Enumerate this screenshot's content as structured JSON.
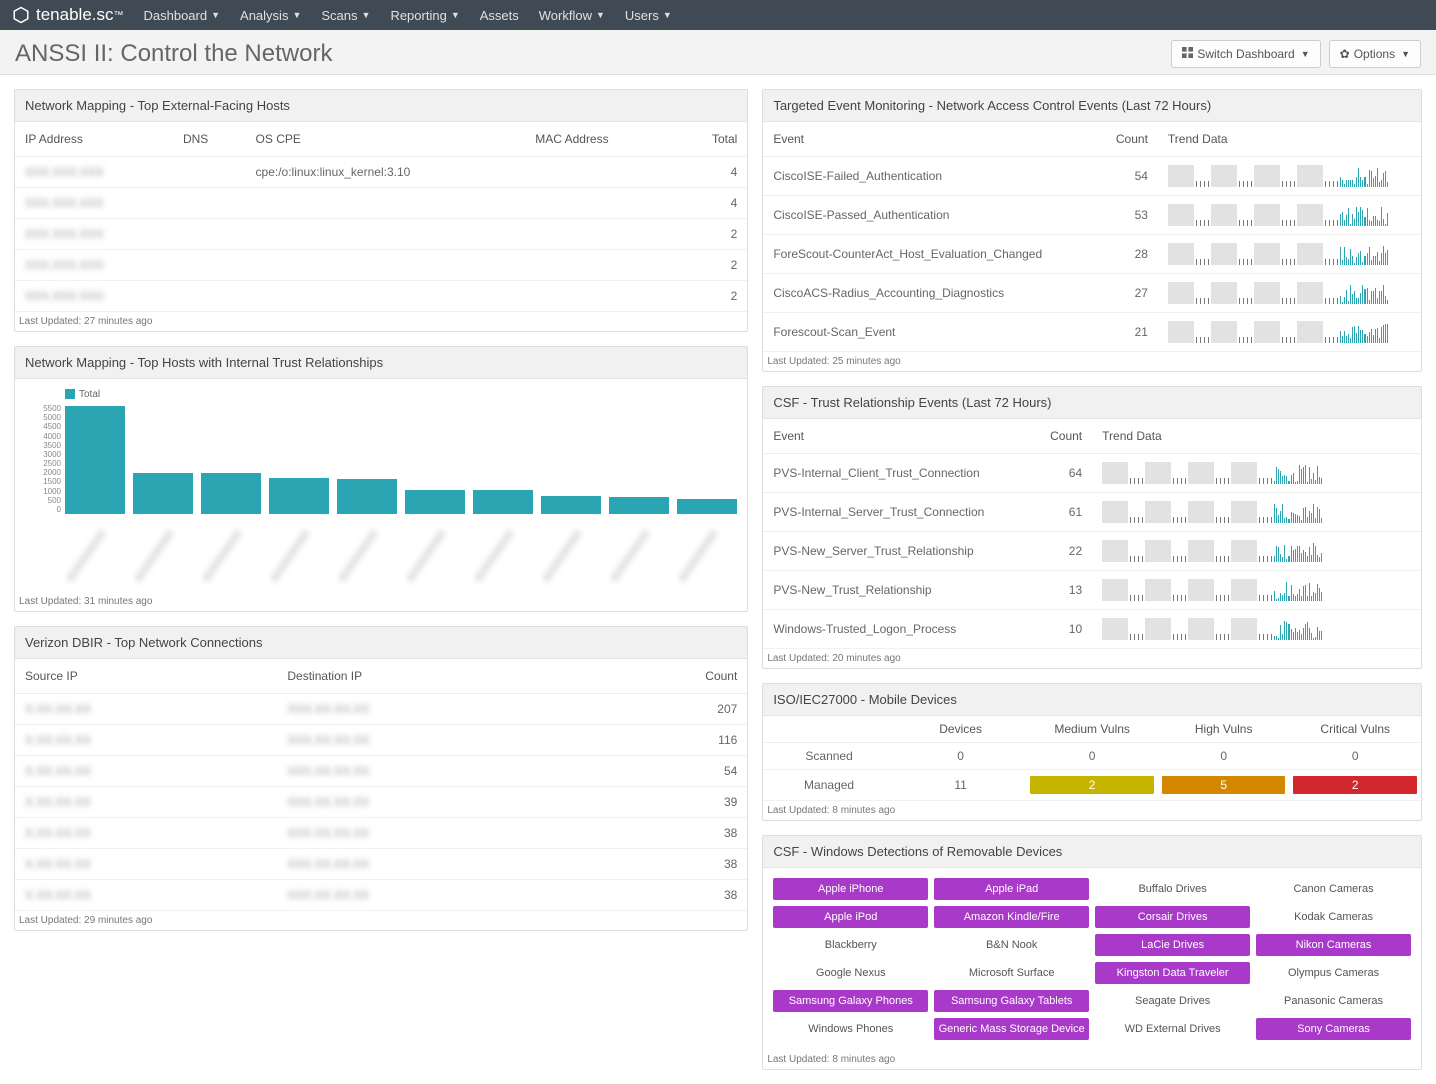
{
  "nav": {
    "brand": "tenable.sc",
    "items": [
      "Dashboard",
      "Analysis",
      "Scans",
      "Reporting",
      "Assets",
      "Workflow",
      "Users"
    ]
  },
  "header": {
    "title": "ANSSI II: Control the Network",
    "switch_label": "Switch Dashboard",
    "options_label": "Options"
  },
  "panels": {
    "ext_hosts": {
      "title": "Network Mapping - Top External-Facing Hosts",
      "columns": [
        "IP Address",
        "DNS",
        "OS CPE",
        "MAC Address",
        "Total"
      ],
      "rows": [
        {
          "ip": "XXX.XXX.XXX",
          "dns": "",
          "cpe": "cpe:/o:linux:linux_kernel:3.10",
          "mac": "",
          "total": 4
        },
        {
          "ip": "XXX.XXX.XXX",
          "dns": "",
          "cpe": "",
          "mac": "",
          "total": 4
        },
        {
          "ip": "XXX.XXX.XXX",
          "dns": "",
          "cpe": "",
          "mac": "",
          "total": 2
        },
        {
          "ip": "XXX.XXX.XXX",
          "dns": "",
          "cpe": "",
          "mac": "",
          "total": 2
        },
        {
          "ip": "XXX.XXX.XXX",
          "dns": "",
          "cpe": "",
          "mac": "",
          "total": 2
        }
      ],
      "footer": "Last Updated: 27 minutes ago"
    },
    "trust_hosts": {
      "title": "Network Mapping - Top Hosts with Internal Trust Relationships",
      "legend": "Total",
      "footer": "Last Updated: 31 minutes ago"
    },
    "dbir": {
      "title": "Verizon DBIR - Top Network Connections",
      "columns": [
        "Source IP",
        "Destination IP",
        "Count"
      ],
      "rows": [
        {
          "src": "X.XX.XX.XX",
          "dst": "XXX.XX.XX.XX",
          "count": 207
        },
        {
          "src": "X.XX.XX.XX",
          "dst": "XXX.XX.XX.XX",
          "count": 116
        },
        {
          "src": "X.XX.XX.XX",
          "dst": "XXX.XX.XX.XX",
          "count": 54
        },
        {
          "src": "X.XX.XX.XX",
          "dst": "XXX.XX.XX.XX",
          "count": 39
        },
        {
          "src": "X.XX.XX.XX",
          "dst": "XXX.XX.XX.XX",
          "count": 38
        },
        {
          "src": "X.XX.XX.XX",
          "dst": "XXX.XX.XX.XX",
          "count": 38
        },
        {
          "src": "X.XX.XX.XX",
          "dst": "XXX.XX.XX.XX",
          "count": 38
        }
      ],
      "footer": "Last Updated: 29 minutes ago"
    },
    "nac_events": {
      "title": "Targeted Event Monitoring - Network Access Control Events (Last 72 Hours)",
      "columns": [
        "Event",
        "Count",
        "Trend Data"
      ],
      "rows": [
        {
          "event": "CiscoISE-Failed_Authentication",
          "count": 54
        },
        {
          "event": "CiscoISE-Passed_Authentication",
          "count": 53
        },
        {
          "event": "ForeScout-CounterAct_Host_Evaluation_Changed",
          "count": 28
        },
        {
          "event": "CiscoACS-Radius_Accounting_Diagnostics",
          "count": 27
        },
        {
          "event": "Forescout-Scan_Event",
          "count": 21
        }
      ],
      "footer": "Last Updated: 25 minutes ago"
    },
    "csf_trust": {
      "title": "CSF - Trust Relationship Events (Last 72 Hours)",
      "columns": [
        "Event",
        "Count",
        "Trend Data"
      ],
      "rows": [
        {
          "event": "PVS-Internal_Client_Trust_Connection",
          "count": 64
        },
        {
          "event": "PVS-Internal_Server_Trust_Connection",
          "count": 61
        },
        {
          "event": "PVS-New_Server_Trust_Relationship",
          "count": 22
        },
        {
          "event": "PVS-New_Trust_Relationship",
          "count": 13
        },
        {
          "event": "Windows-Trusted_Logon_Process",
          "count": 10
        }
      ],
      "footer": "Last Updated: 20 minutes ago"
    },
    "mobile": {
      "title": "ISO/IEC27000 - Mobile Devices",
      "columns": [
        "",
        "Devices",
        "Medium Vulns",
        "High Vulns",
        "Critical Vulns"
      ],
      "rows": [
        {
          "label": "Scanned",
          "devices": 0,
          "med": "0",
          "high": "0",
          "crit": "0",
          "colored": false
        },
        {
          "label": "Managed",
          "devices": 11,
          "med": "2",
          "high": "5",
          "crit": "2",
          "colored": true
        }
      ],
      "footer": "Last Updated: 8 minutes ago"
    },
    "removable": {
      "title": "CSF - Windows Detections of Removable Devices",
      "items": [
        {
          "label": "Apple iPhone",
          "on": true
        },
        {
          "label": "Apple iPad",
          "on": true
        },
        {
          "label": "Buffalo Drives",
          "on": false
        },
        {
          "label": "Canon Cameras",
          "on": false
        },
        {
          "label": "Apple iPod",
          "on": true
        },
        {
          "label": "Amazon Kindle/Fire",
          "on": true
        },
        {
          "label": "Corsair Drives",
          "on": true
        },
        {
          "label": "Kodak Cameras",
          "on": false
        },
        {
          "label": "Blackberry",
          "on": false
        },
        {
          "label": "B&N Nook",
          "on": false
        },
        {
          "label": "LaCie Drives",
          "on": true
        },
        {
          "label": "Nikon Cameras",
          "on": true
        },
        {
          "label": "Google Nexus",
          "on": false
        },
        {
          "label": "Microsoft Surface",
          "on": false
        },
        {
          "label": "Kingston Data Traveler",
          "on": true
        },
        {
          "label": "Olympus Cameras",
          "on": false
        },
        {
          "label": "Samsung Galaxy Phones",
          "on": true
        },
        {
          "label": "Samsung Galaxy Tablets",
          "on": true
        },
        {
          "label": "Seagate Drives",
          "on": false
        },
        {
          "label": "Panasonic Cameras",
          "on": false
        },
        {
          "label": "Windows Phones",
          "on": false
        },
        {
          "label": "Generic Mass Storage Device",
          "on": true
        },
        {
          "label": "WD External Drives",
          "on": false
        },
        {
          "label": "Sony Cameras",
          "on": true
        }
      ],
      "footer": "Last Updated: 8 minutes ago"
    }
  },
  "chart_data": {
    "type": "bar",
    "title": "Network Mapping - Top Hosts with Internal Trust Relationships",
    "ylabel": "Total",
    "ylim": [
      0,
      5500
    ],
    "yticks": [
      0,
      500,
      1000,
      1500,
      2000,
      2500,
      3000,
      3500,
      4000,
      4500,
      5000,
      5500
    ],
    "categories": [
      "host1",
      "host2",
      "host3",
      "host4",
      "host5",
      "host6",
      "host7",
      "host8",
      "host9",
      "host10"
    ],
    "values": [
      5400,
      2050,
      2050,
      1800,
      1750,
      1200,
      1200,
      900,
      850,
      750
    ]
  }
}
